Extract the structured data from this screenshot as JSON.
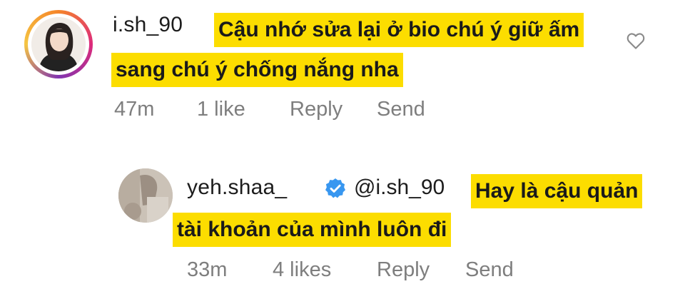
{
  "comment": {
    "username": "i.sh_90",
    "text_line1": "Cậu nhớ sửa lại ở bio chú ý giữ ấm",
    "text_line2": "sang chú ý chống nắng nha",
    "time": "47m",
    "likes": "1 like",
    "reply_label": "Reply",
    "send_label": "Send"
  },
  "reply": {
    "username": "yeh.shaa_",
    "mention": "@i.sh_90",
    "text_line1": "Hay là cậu quản",
    "text_line2": "tài khoản của mình luôn đi",
    "time": "33m",
    "likes": "4 likes",
    "reply_label": "Reply",
    "send_label": "Send"
  },
  "icons": {
    "like": "heart-icon",
    "verified": "verified-badge-icon"
  },
  "colors": {
    "highlight": "#fcdd00",
    "verified": "#3897f0",
    "meta_text": "#7e7e7e"
  }
}
